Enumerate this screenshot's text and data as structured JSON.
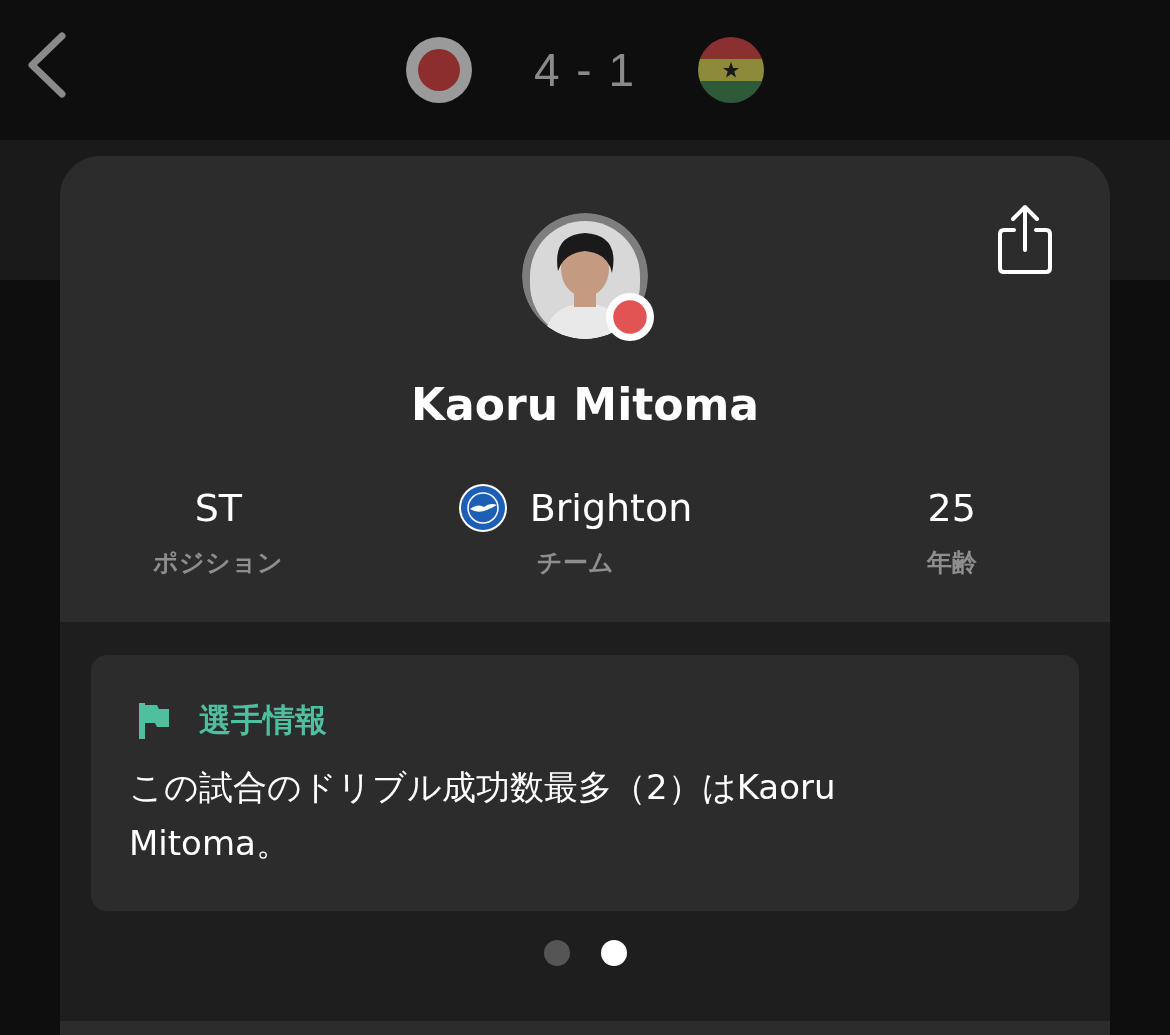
{
  "header": {
    "home_flag": {
      "kind": "japan"
    },
    "score": "4 - 1",
    "away_flag": {
      "kind": "ghana"
    }
  },
  "player_card": {
    "nation": {
      "kind": "japan"
    },
    "name": "Kaoru Mitoma",
    "stats": [
      {
        "kind": "text",
        "value": "ST",
        "label": "ポジション"
      },
      {
        "kind": "club",
        "value": "Brighton",
        "label": "チーム"
      },
      {
        "kind": "text",
        "value": "25",
        "label": "年齢"
      }
    ],
    "insight": {
      "title": "選手情報",
      "text": "この試合のドリブル成功数最多（2）はKaoru Mitoma。"
    },
    "pages": [
      {
        "selected": false
      },
      {
        "selected": true
      }
    ]
  }
}
